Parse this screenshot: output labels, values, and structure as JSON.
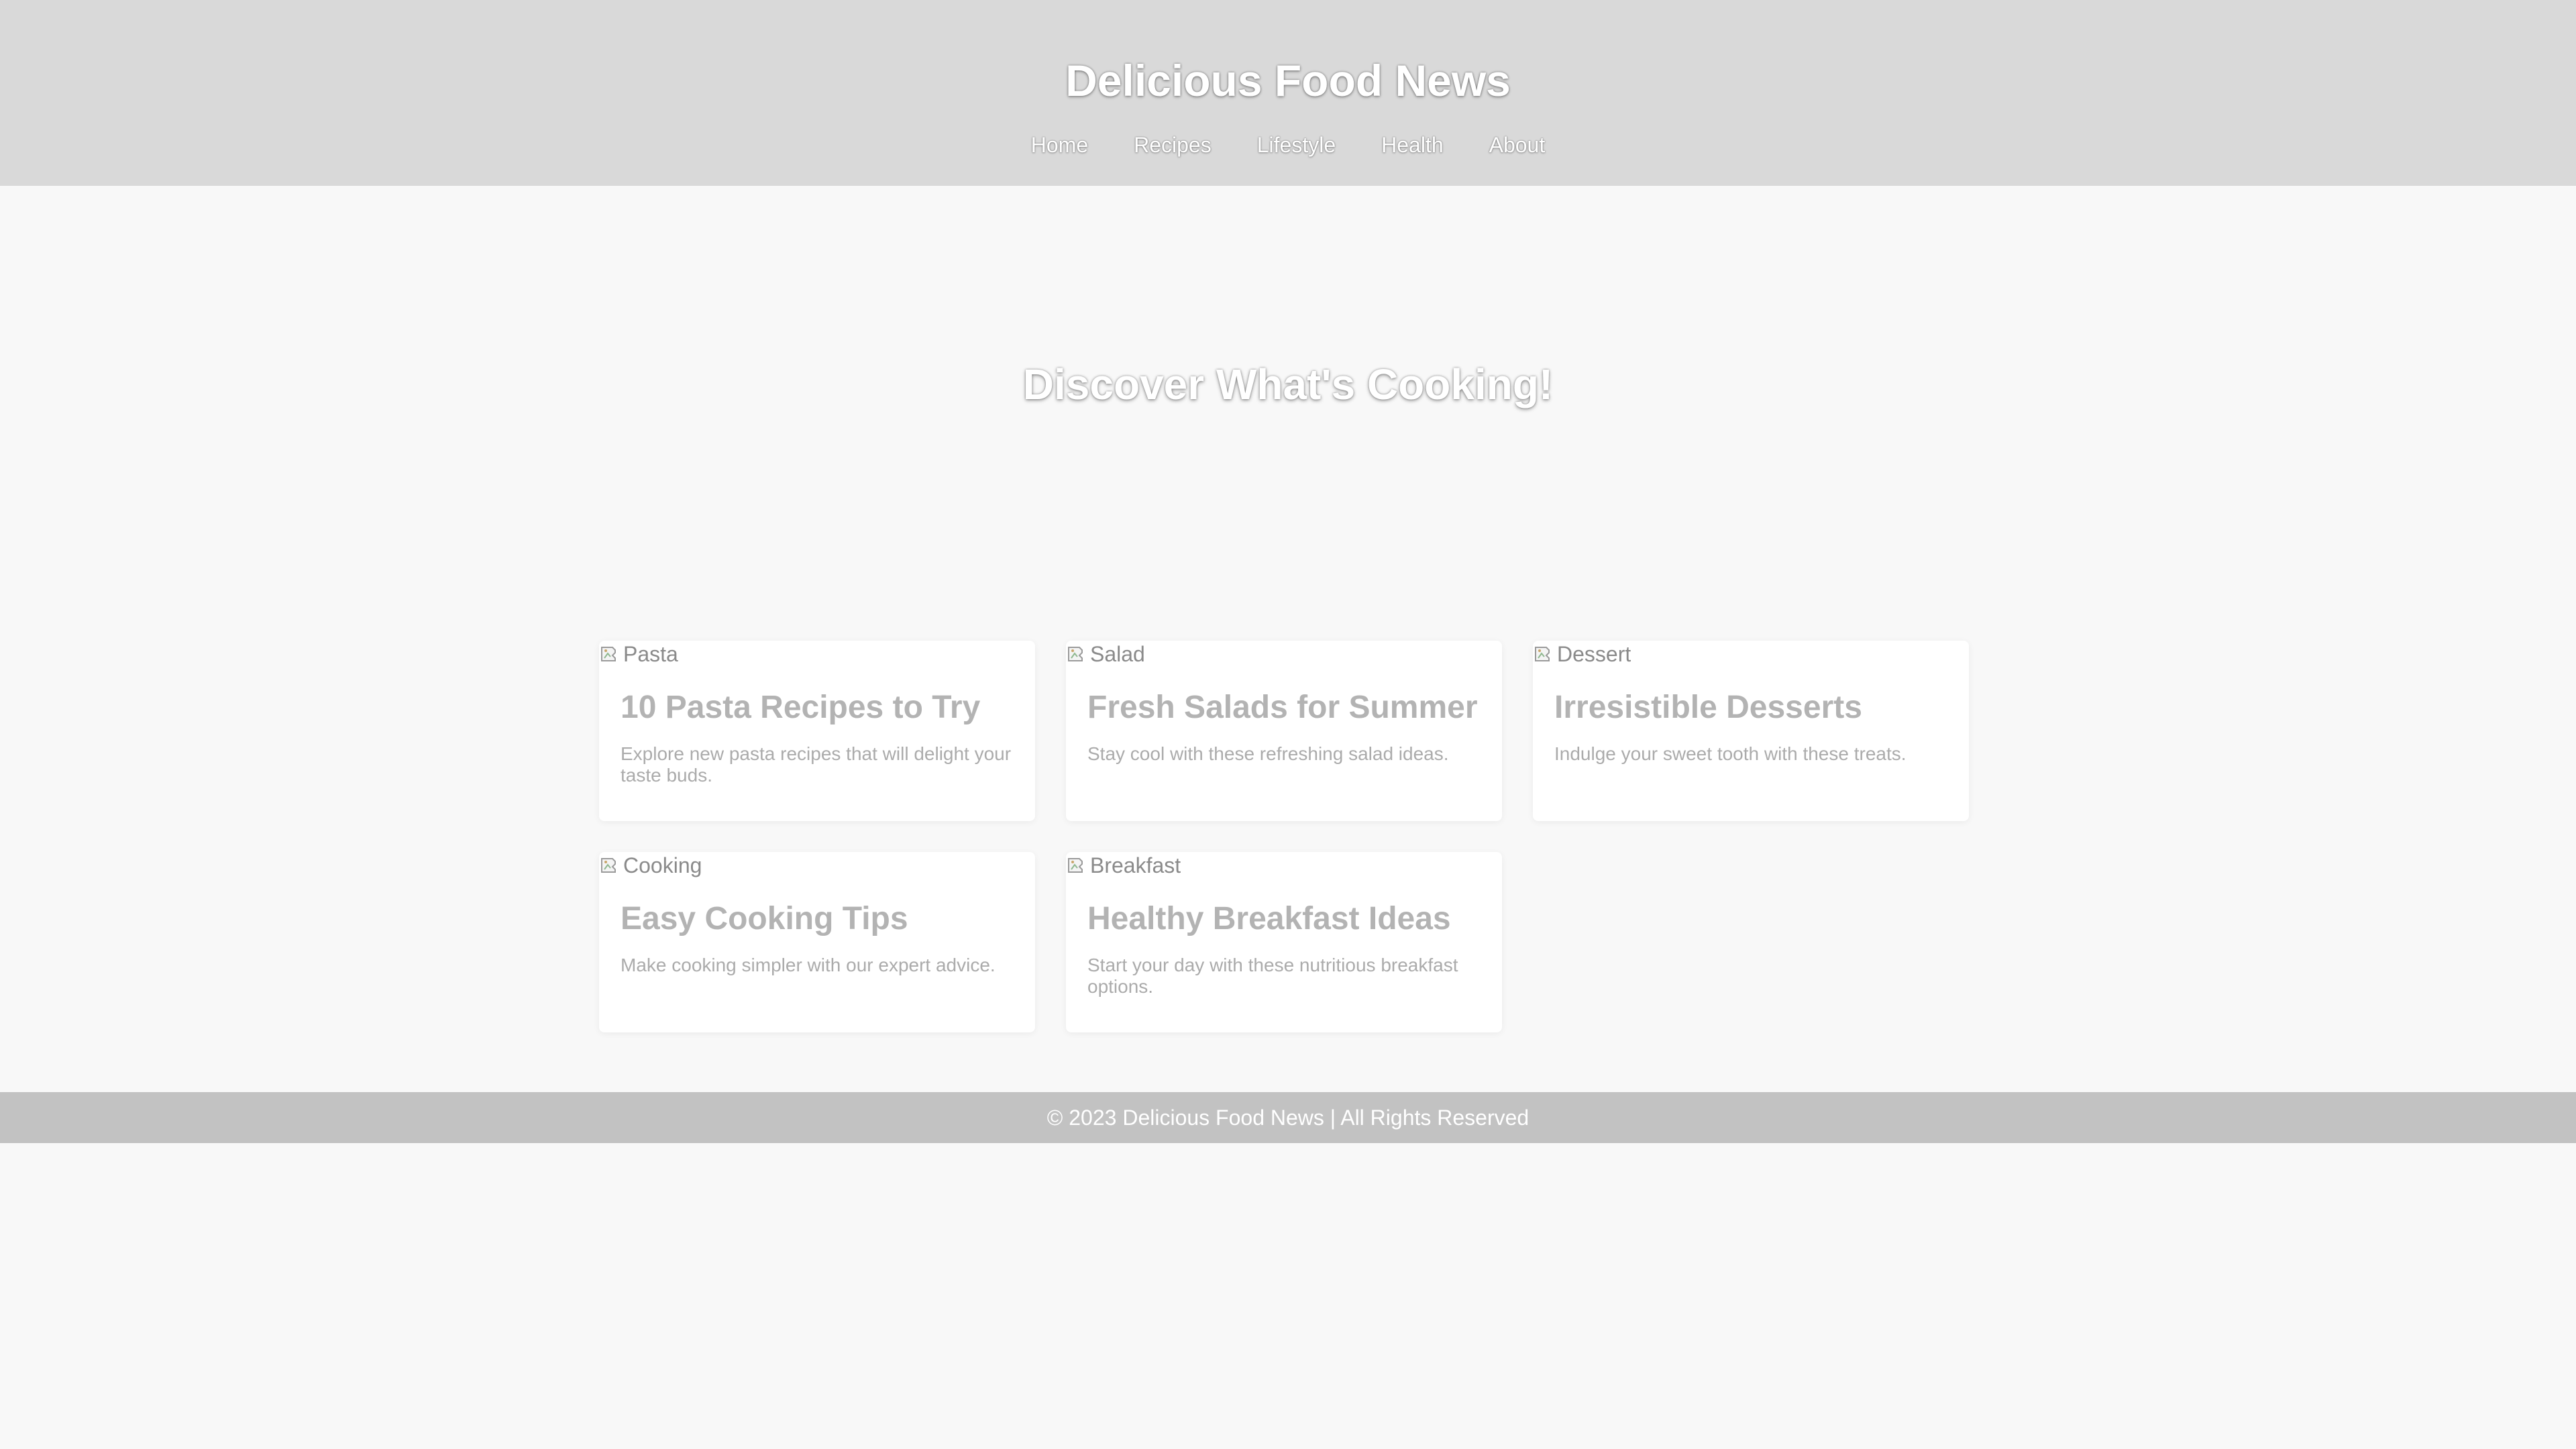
{
  "header": {
    "title": "Delicious Food News",
    "nav": [
      "Home",
      "Recipes",
      "Lifestyle",
      "Health",
      "About"
    ]
  },
  "hero": {
    "title": "Discover What's Cooking!"
  },
  "articles": [
    {
      "image_alt": "Pasta",
      "title": "10 Pasta Recipes to Try",
      "description": "Explore new pasta recipes that will delight your taste buds."
    },
    {
      "image_alt": "Salad",
      "title": "Fresh Salads for Summer",
      "description": "Stay cool with these refreshing salad ideas."
    },
    {
      "image_alt": "Dessert",
      "title": "Irresistible Desserts",
      "description": "Indulge your sweet tooth with these treats."
    },
    {
      "image_alt": "Cooking",
      "title": "Easy Cooking Tips",
      "description": "Make cooking simpler with our expert advice."
    },
    {
      "image_alt": "Breakfast",
      "title": "Healthy Breakfast Ideas",
      "description": "Start your day with these nutritious breakfast options."
    }
  ],
  "footer": {
    "text": "© 2023 Delicious Food News | All Rights Reserved"
  },
  "colors": {
    "header_bg": "#d9d9d9",
    "footer_bg": "#c2c2c2",
    "page_bg": "#f8f8f8",
    "card_title": "#b3b3b3"
  },
  "icons": {
    "card_image": "broken-image-icon"
  }
}
